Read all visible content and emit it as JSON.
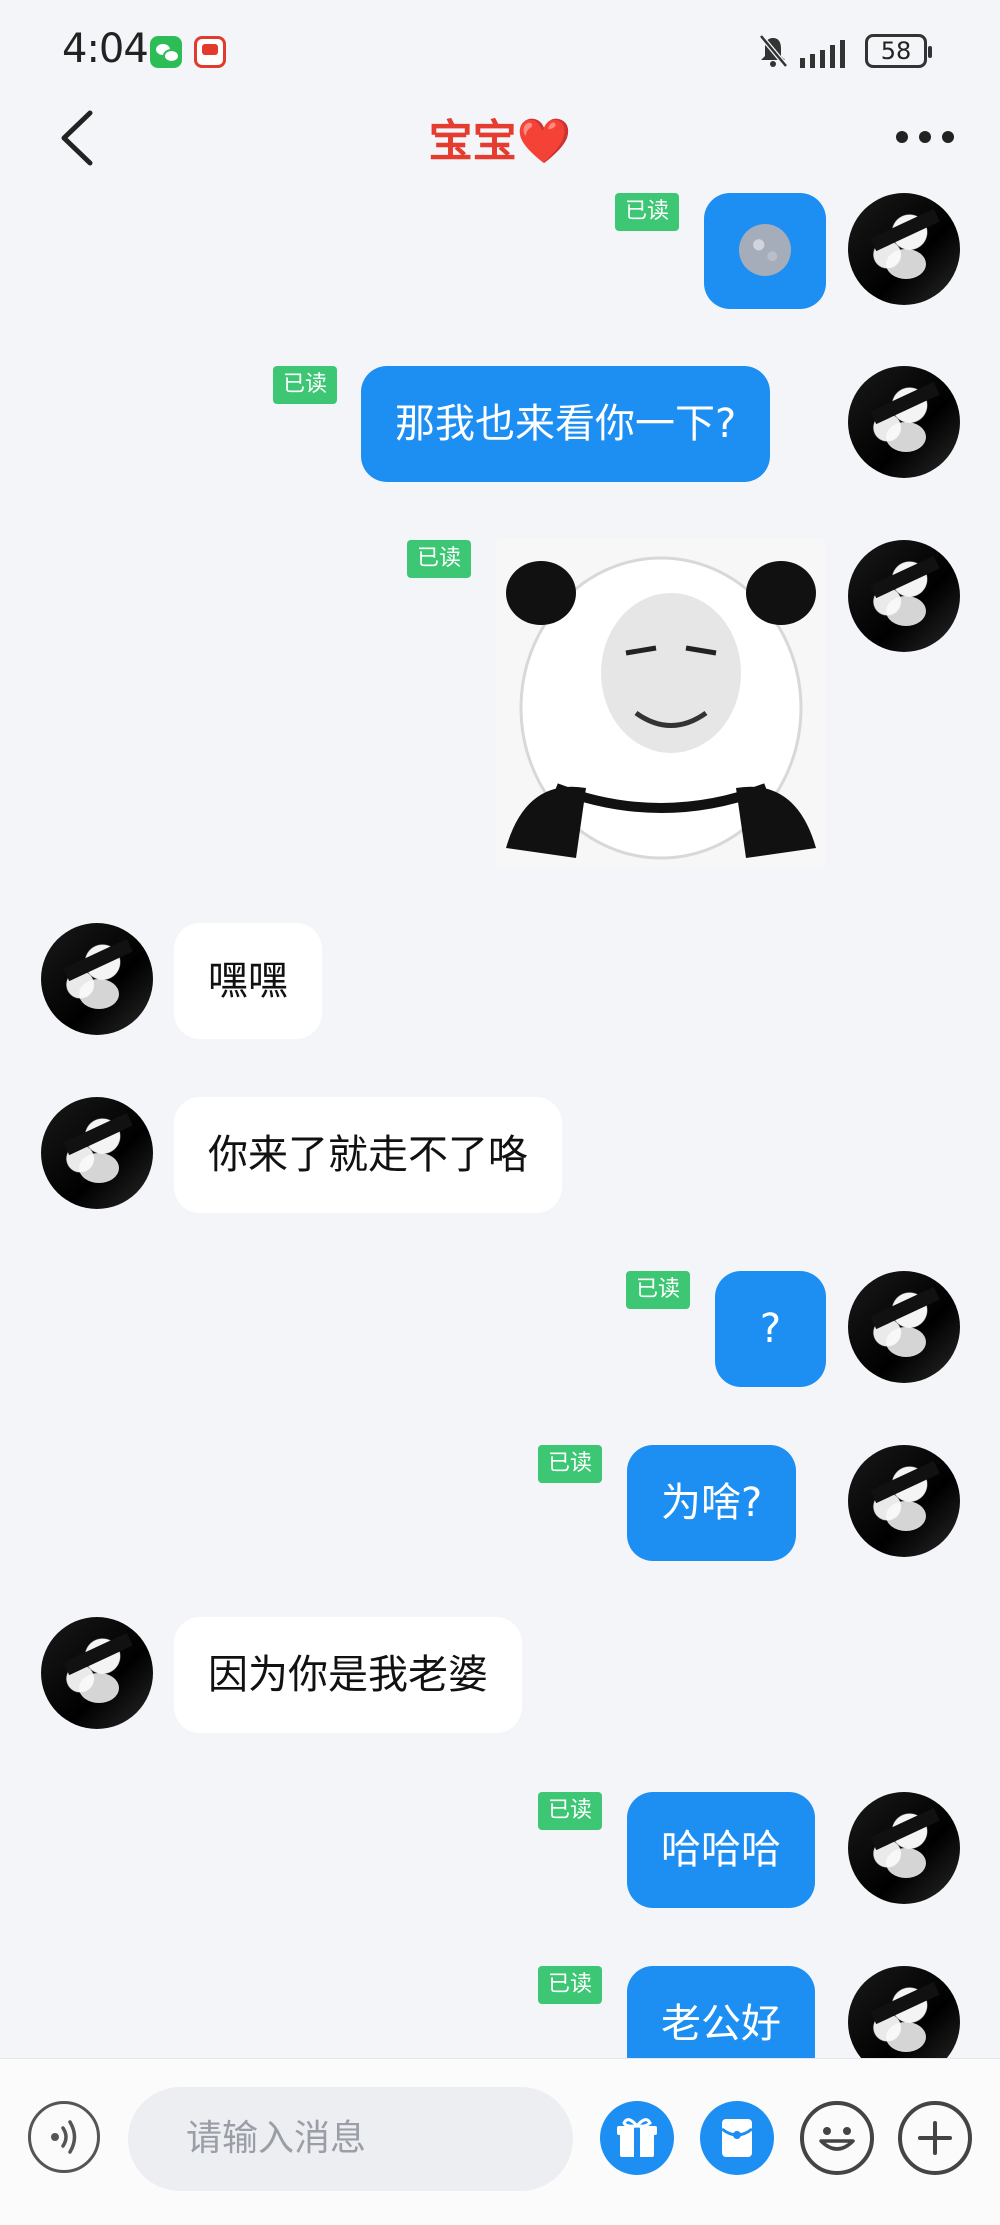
{
  "status": {
    "time": "4:04",
    "battery": "58"
  },
  "header": {
    "title": "宝宝❤️"
  },
  "messages": {
    "m1": {
      "read": "已读"
    },
    "m2": {
      "text": "那我也来看你一下?",
      "read": "已读"
    },
    "m3": {
      "read": "已读"
    },
    "m4": {
      "text": "嘿嘿"
    },
    "m5": {
      "text": "你来了就走不了咯"
    },
    "m6": {
      "text": "?",
      "read": "已读"
    },
    "m7": {
      "text": "为啥?",
      "read": "已读"
    },
    "m8": {
      "text": "因为你是我老婆"
    },
    "m9": {
      "text": "哈哈哈",
      "read": "已读"
    },
    "m10": {
      "text": "老公好",
      "read": "已读"
    }
  },
  "composer": {
    "placeholder": "请输入消息"
  },
  "colors": {
    "outgoing": "#1e8ff2",
    "read_badge": "#3dc774",
    "title": "#e63c2f"
  }
}
